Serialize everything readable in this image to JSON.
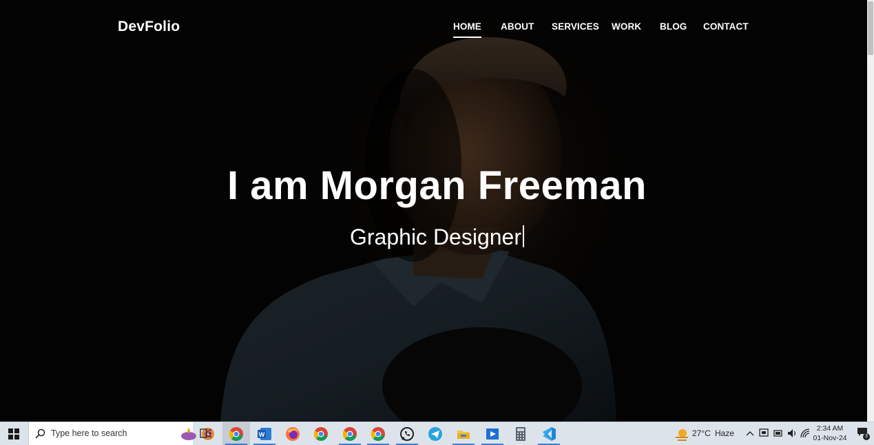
{
  "site": {
    "logo": "DevFolio",
    "nav": [
      {
        "label": "HOME",
        "active": true
      },
      {
        "label": "ABOUT",
        "active": false
      },
      {
        "label": "SERVICES",
        "active": false
      },
      {
        "label": "WORK",
        "active": false
      },
      {
        "label": "BLOG",
        "active": false
      },
      {
        "label": "CONTACT",
        "active": false
      }
    ],
    "headline": "I am Morgan Freeman",
    "subline": "Graphic Designer"
  },
  "taskbar": {
    "search_placeholder": "Type here to search",
    "apps": [
      {
        "name": "chrome-icon",
        "running": true,
        "active": true
      },
      {
        "name": "word-icon",
        "running": true,
        "active": false
      },
      {
        "name": "firefox-icon",
        "running": false,
        "active": false
      },
      {
        "name": "chrome-icon",
        "running": false,
        "active": false
      },
      {
        "name": "chrome-icon",
        "running": true,
        "active": false
      },
      {
        "name": "chrome-icon",
        "running": true,
        "active": false
      },
      {
        "name": "whatsapp-icon",
        "running": true,
        "active": false
      },
      {
        "name": "telegram-icon",
        "running": false,
        "active": false
      },
      {
        "name": "file-explorer-icon",
        "running": true,
        "active": false
      },
      {
        "name": "media-player-icon",
        "running": true,
        "active": false
      },
      {
        "name": "calculator-icon",
        "running": false,
        "active": false
      },
      {
        "name": "vscode-icon",
        "running": true,
        "active": false
      }
    ],
    "weather": {
      "temp": "27°C",
      "condition": "Haze"
    },
    "clock": {
      "time": "2:34 AM",
      "date": "01-Nov-24"
    },
    "notification_count": "3"
  },
  "colors": {
    "taskbar_bg": "#dde3ea",
    "accent": "#3a7bd5",
    "hero_text": "#ffffff"
  }
}
